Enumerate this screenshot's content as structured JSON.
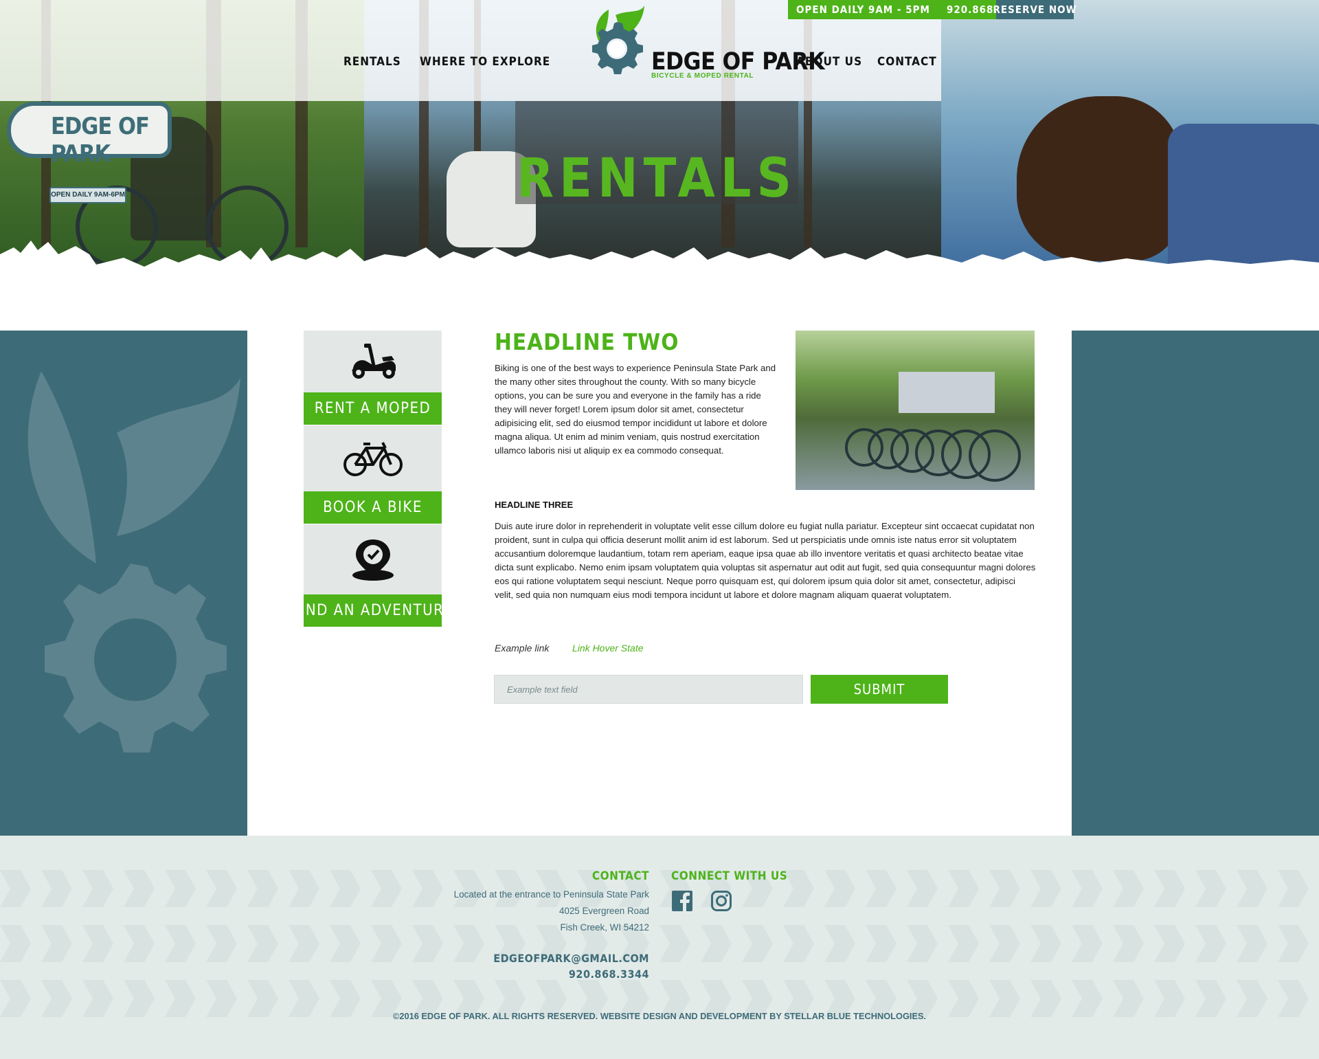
{
  "topbar": {
    "hours": "OPEN DAILY 9AM - 5PM",
    "phone": "920.868.3344",
    "reserve": "RESERVE NOW"
  },
  "nav": {
    "left": [
      "RENTALS",
      "WHERE TO EXPLORE"
    ],
    "right": [
      "ABOUT US",
      "CONTACT"
    ]
  },
  "logo": {
    "title": "EDGE OF PARK",
    "subtitle": "BICYCLE & MOPED RENTAL"
  },
  "hero": {
    "title": "RENTALS",
    "sign_title": "EDGE OF PARK",
    "sign_hours": "OPEN DAILY 9AM-6PM"
  },
  "sidebar": {
    "items": [
      {
        "label": "RENT A MOPED",
        "icon": "moped-icon"
      },
      {
        "label": "BOOK A BIKE",
        "icon": "bicycle-icon"
      },
      {
        "label": "FIND AN ADVENTURE",
        "icon": "map-pin-icon"
      }
    ]
  },
  "main": {
    "headline_two": "HEADLINE TWO",
    "para_one": "Biking is one of the best ways to experience Peninsula State Park and the many other sites throughout the county. With so many bicycle options, you can be sure you and everyone in the family has a ride they will never forget! Lorem ipsum dolor sit amet, consectetur adipisicing elit, sed do eiusmod tempor incididunt ut labore et dolore magna aliqua. Ut enim ad minim veniam, quis nostrud exercitation ullamco laboris nisi ut aliquip ex ea commodo consequat.",
    "headline_three": "HEADLINE THREE",
    "para_two": "Duis aute irure dolor in reprehenderit in voluptate velit esse cillum dolore eu fugiat nulla pariatur. Excepteur sint occaecat cupidatat non proident, sunt in culpa qui officia deserunt mollit anim id est laborum. Sed ut perspiciatis unde omnis iste natus error sit voluptatem accusantium doloremque laudantium, totam rem aperiam, eaque ipsa quae ab illo inventore veritatis et quasi architecto beatae vitae dicta sunt explicabo. Nemo enim ipsam voluptatem quia voluptas sit aspernatur aut odit aut fugit, sed quia consequuntur magni dolores eos qui ratione voluptatem sequi nesciunt. Neque porro quisquam est, qui dolorem ipsum quia dolor sit amet, consectetur, adipisci velit, sed quia non numquam eius modi tempora incidunt ut labore et dolore magnam aliquam quaerat voluptatem.",
    "example_link": "Example link",
    "hover_link": "Link Hover State",
    "text_field_placeholder": "Example text field",
    "submit": "SUBMIT"
  },
  "footer": {
    "contact_heading": "CONTACT",
    "connect_heading": "CONNECT WITH US",
    "address": [
      "Located at the entrance to Peninsula State Park",
      "4025 Evergreen Road",
      "Fish Creek, WI 54212"
    ],
    "email": "EDGEOFPARK@GMAIL.COM",
    "phone": "920.868.3344",
    "social": [
      "facebook-icon",
      "instagram-icon"
    ],
    "copyright": "©2016 EDGE OF PARK. ALL RIGHTS RESERVED. WEBSITE DESIGN AND DEVELOPMENT BY STELLAR BLUE TECHNOLOGIES."
  },
  "colors": {
    "green": "#4db319",
    "teal": "#3e6b78",
    "light": "#e3e8e7"
  }
}
